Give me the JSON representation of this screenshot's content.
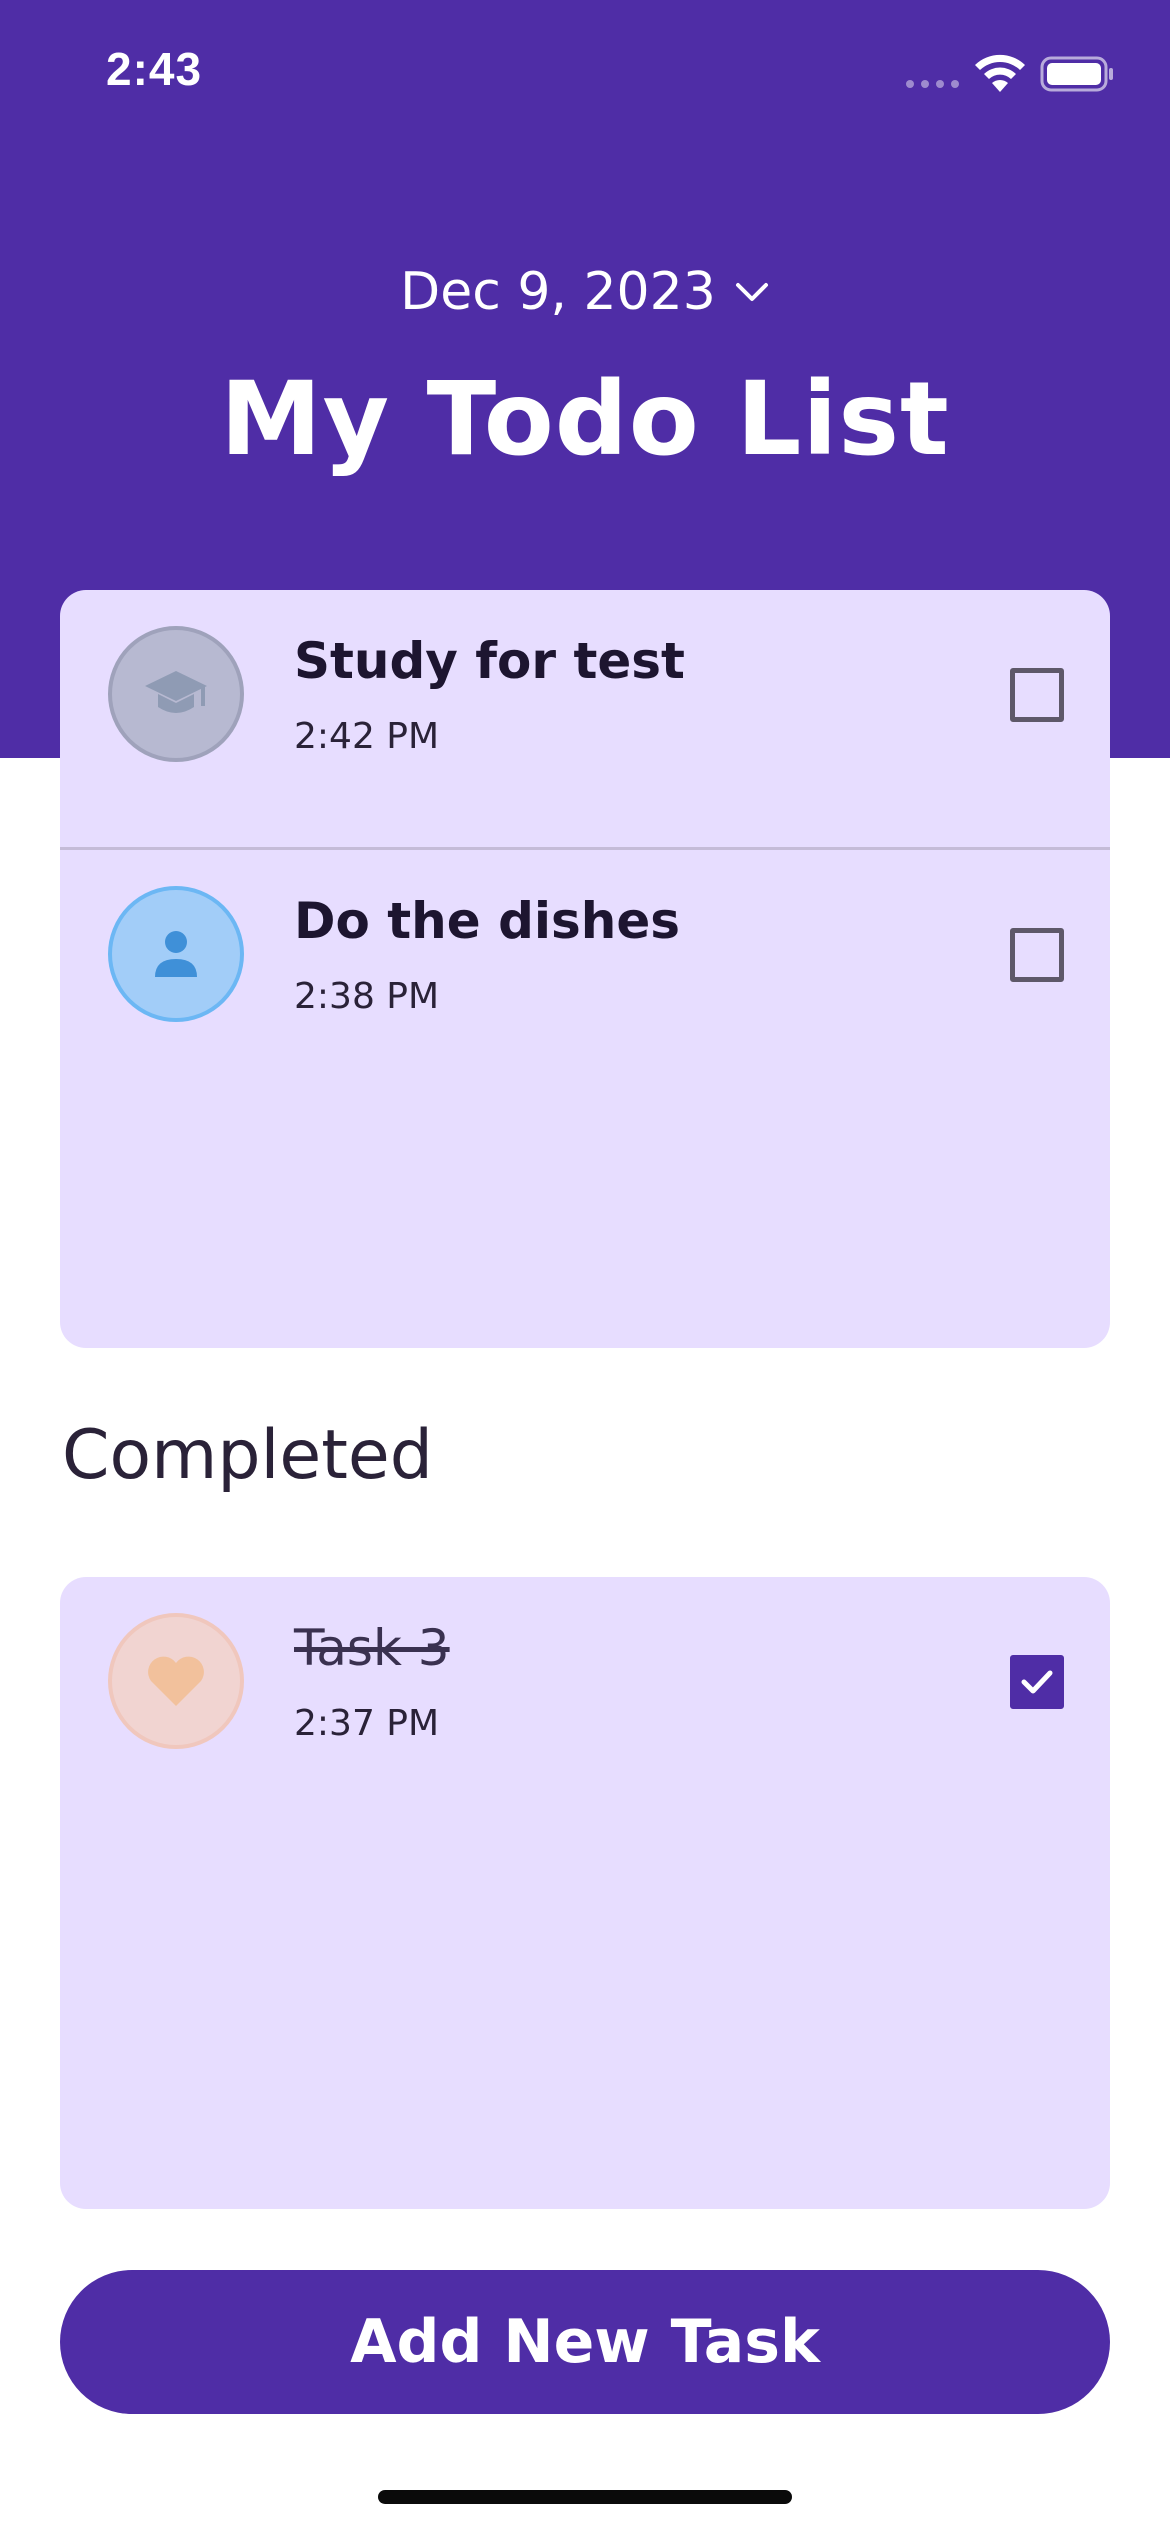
{
  "status_bar": {
    "time": "2:43"
  },
  "header": {
    "date": "Dec 9, 2023",
    "title": "My Todo List"
  },
  "active_tasks": [
    {
      "title": "Study for test",
      "time": "2:42 PM",
      "icon": "graduation-cap-icon",
      "checked": false
    },
    {
      "title": "Do the dishes",
      "time": "2:38 PM",
      "icon": "person-icon",
      "checked": false
    }
  ],
  "completed_section": {
    "heading": "Completed"
  },
  "completed_tasks": [
    {
      "title": "Task 3",
      "time": "2:37 PM",
      "icon": "heart-icon",
      "checked": true
    }
  ],
  "add_button": {
    "label": "Add New Task"
  },
  "colors": {
    "primary": "#4f2da6",
    "card_background": "#e7ddff",
    "study_avatar": "#b7b9d1",
    "person_avatar": "#a2cdf8",
    "heart_avatar": "#f1d4d1"
  }
}
